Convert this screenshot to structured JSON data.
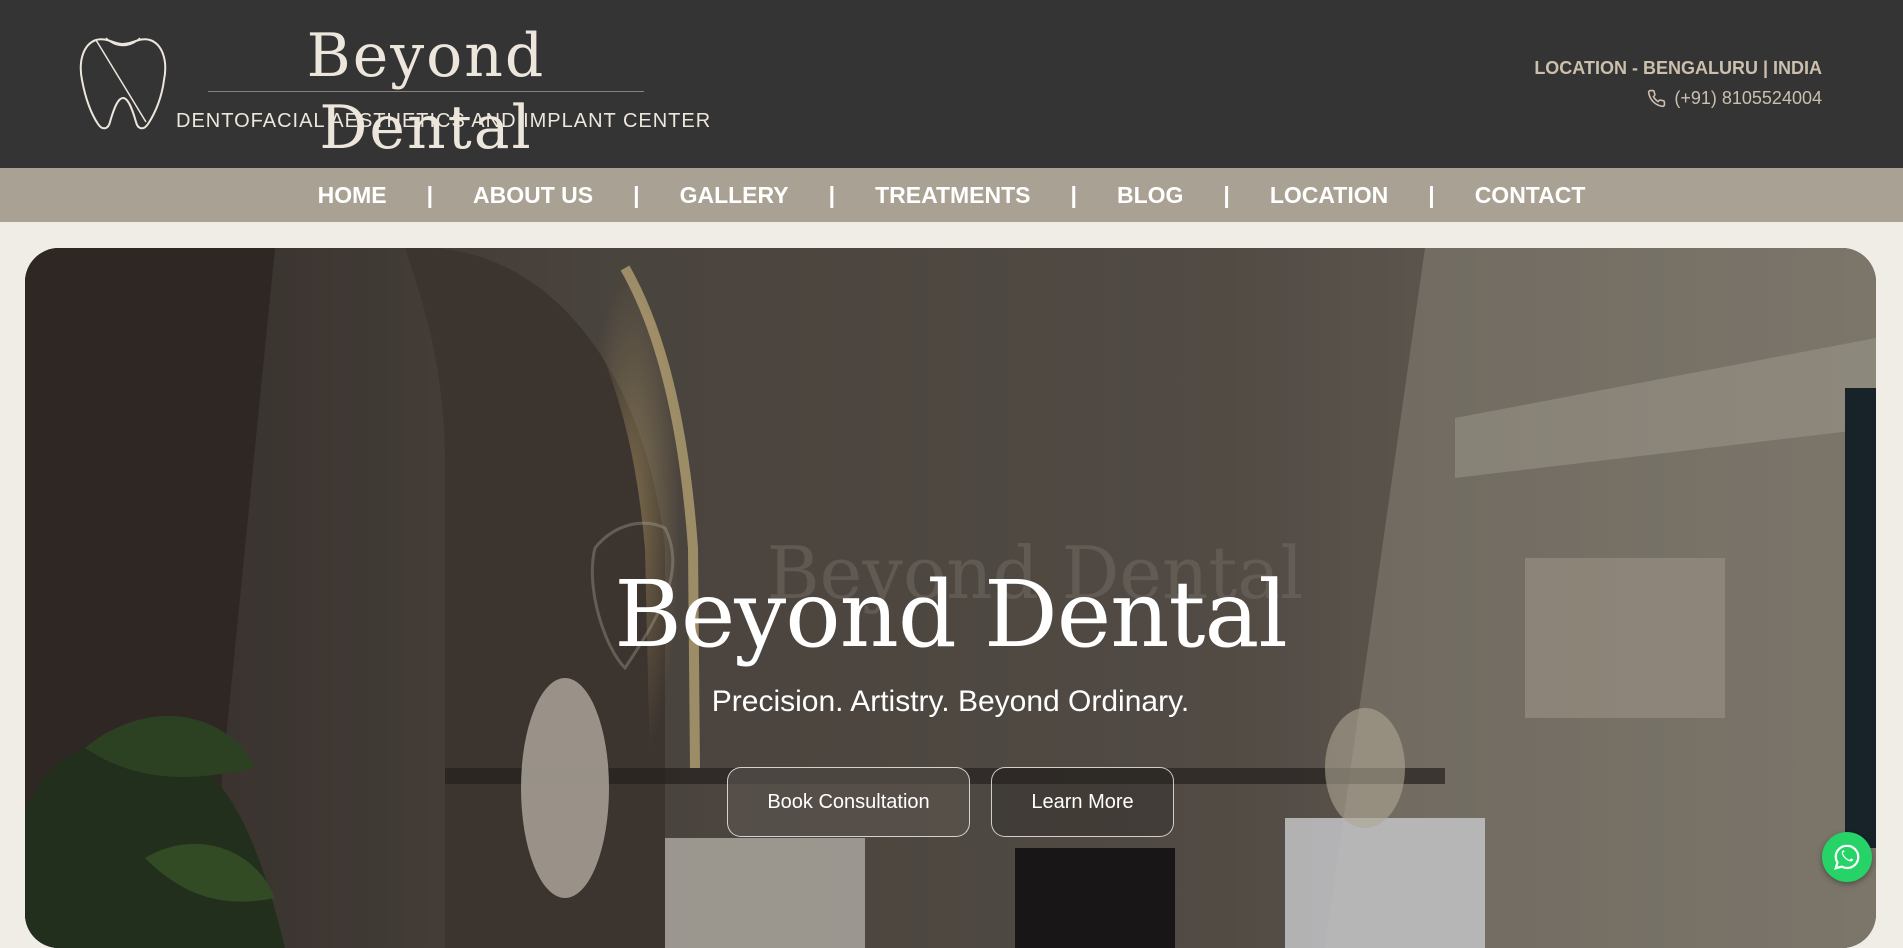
{
  "header": {
    "brand_name": "Beyond Dental",
    "tagline": "DENTOFACIAL AESTHETICS AND IMPLANT CENTER",
    "location": "LOCATION - BENGALURU | INDIA",
    "phone": "(+91) 8105524004"
  },
  "nav": {
    "items": [
      {
        "label": "HOME"
      },
      {
        "label": "ABOUT US"
      },
      {
        "label": "GALLERY"
      },
      {
        "label": "TREATMENTS"
      },
      {
        "label": "BLOG"
      },
      {
        "label": "LOCATION"
      },
      {
        "label": "CONTACT"
      }
    ],
    "separator": "|"
  },
  "hero": {
    "title": "Beyond Dental",
    "subtitle": "Precision. Artistry. Beyond Ordinary.",
    "book_button": "Book Consultation",
    "learn_button": "Learn More"
  },
  "colors": {
    "header_bg": "#353434",
    "nav_bg": "#a9a193",
    "accent_text": "#cbbfae",
    "whatsapp": "#25d366"
  },
  "icons": [
    "tooth-logo-icon",
    "phone-icon",
    "whatsapp-icon"
  ]
}
